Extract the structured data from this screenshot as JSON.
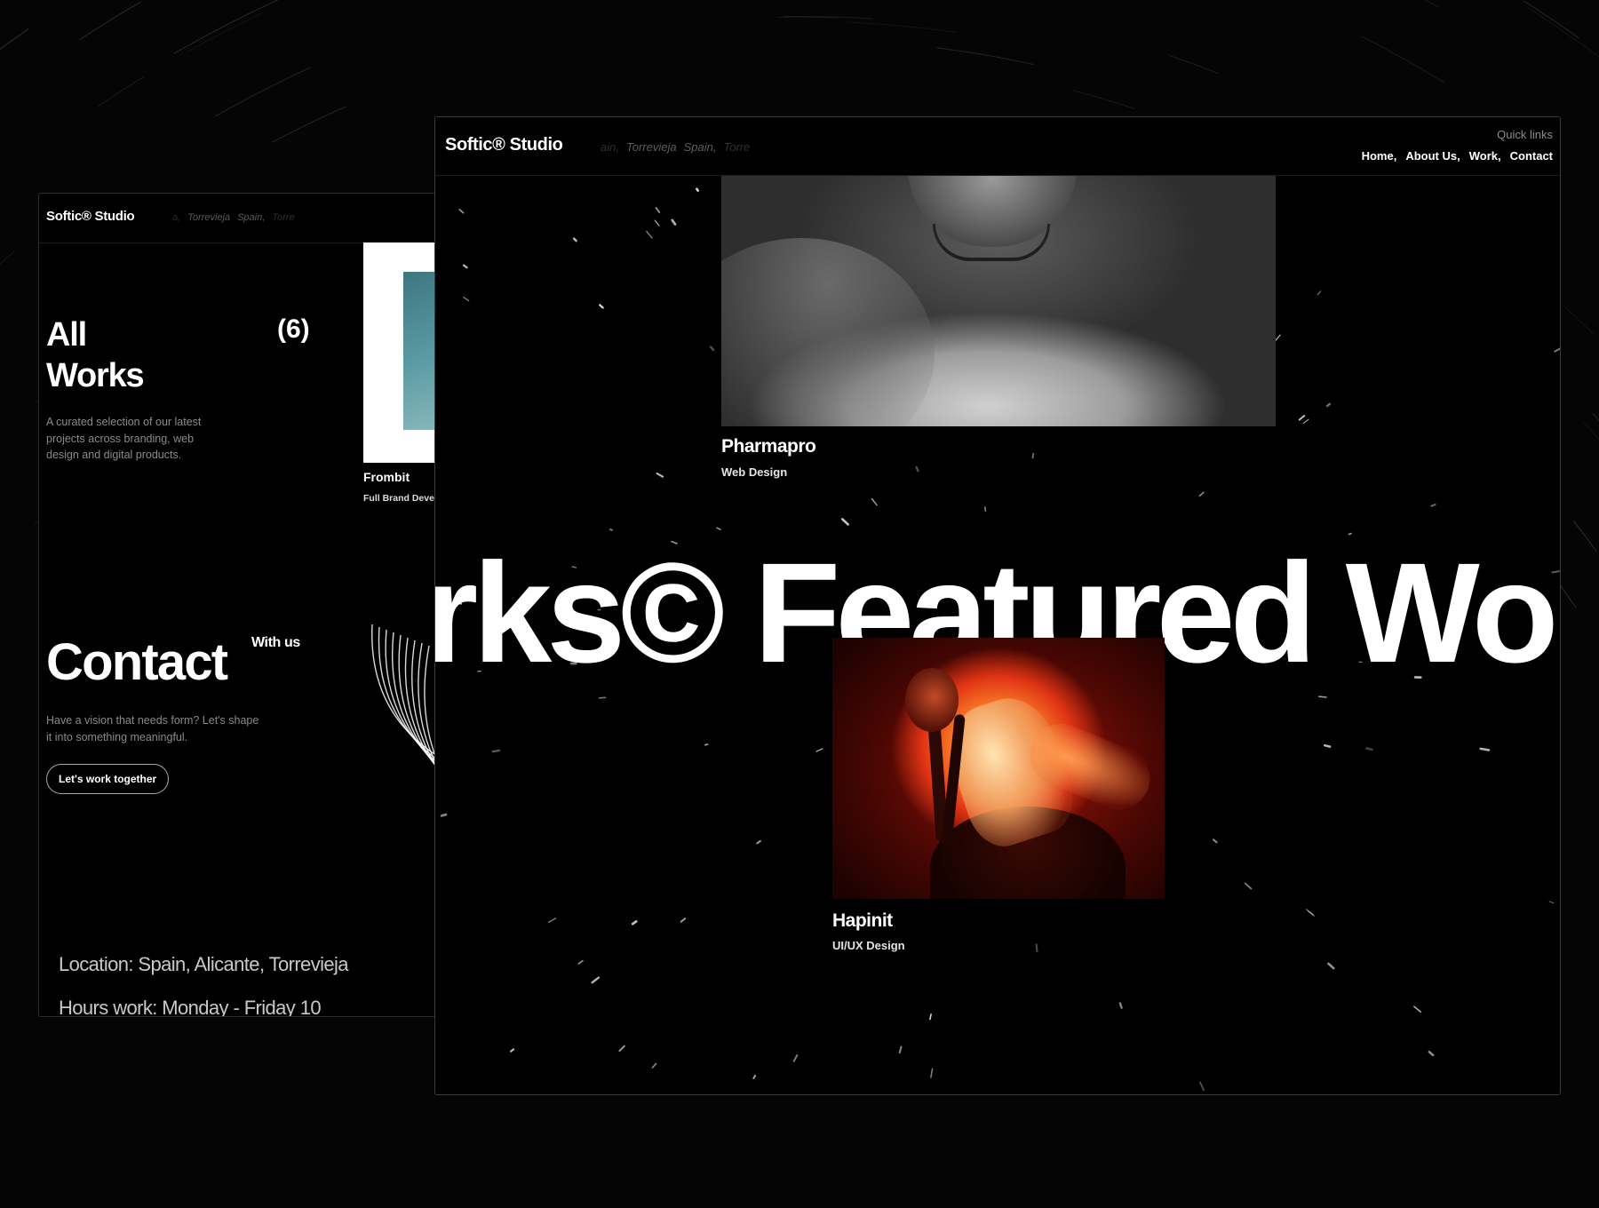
{
  "back_window": {
    "logo": "Softic® Studio",
    "ticker": [
      "a,",
      "Torrevieja",
      "Spain,",
      "Torre"
    ],
    "all_works": {
      "title_line1": "All",
      "title_line2": "Works",
      "count": "(6)",
      "description": "A curated selection of our latest projects across branding, web design and digital products."
    },
    "project": {
      "title": "Frombit",
      "tag": "Full Brand Deve"
    },
    "contact": {
      "title": "Contact",
      "subtitle": "With us",
      "description": "Have a vision that needs form? Let's shape it into something meaningful.",
      "cta": "Let's work together"
    },
    "location": "Location: Spain, Alicante, Torrevieja",
    "hours": "Hours work: Monday - Friday 10"
  },
  "front_window": {
    "logo": "Softic® Studio",
    "ticker": [
      "ain,",
      "Torrevieja",
      "Spain,",
      "Torre"
    ],
    "quick_links_label": "Quick links",
    "nav": [
      "Home,",
      "About Us,",
      "Work,",
      "Contact"
    ],
    "marquee": "rks© Featured Wo",
    "projects": [
      {
        "title": "Pharmapro",
        "tag": "Web Design"
      },
      {
        "title": "Hapinit",
        "tag": "UI/UX Design"
      }
    ]
  },
  "colors": {
    "background": "#050505",
    "window": "#000000",
    "text": "#ffffff",
    "muted": "#8a8a8a",
    "accent_orange": "#e03414"
  },
  "icons": [
    "copyright-icon",
    "registered-icon"
  ]
}
